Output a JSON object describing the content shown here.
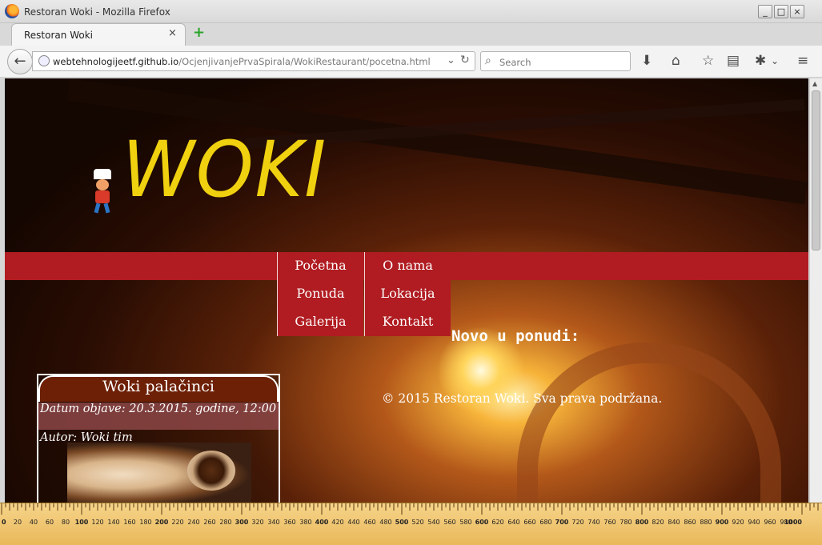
{
  "window": {
    "title": "Restoran Woki - Mozilla Firefox"
  },
  "tab": {
    "label": "Restoran Woki",
    "close": "×",
    "new_tab": "+"
  },
  "nav": {
    "url_host": "webtehnologijeetf.github.io",
    "url_path": "/OcjenjivanjePrvaSpirala/WokiRestaurant/pocetna.html",
    "search_placeholder": "Search"
  },
  "site": {
    "logo": "WOKI",
    "menu": [
      "Početna",
      "O nama",
      "Ponuda",
      "Lokacija",
      "Galerija",
      "Kontakt"
    ],
    "news_heading": "Novo u ponudi:",
    "footer": "© 2015 Restoran Woki. Sva prava podržana.",
    "card": {
      "title": "Woki palačinci",
      "date": "Datum objave: 20.3.2015. godine, 12:00",
      "author": "Autor: Woki tim"
    }
  },
  "ruler": {
    "labels": [
      "0",
      "20",
      "40",
      "60",
      "80",
      "100",
      "120",
      "140",
      "160",
      "180",
      "200",
      "220",
      "240",
      "260",
      "280",
      "300",
      "320",
      "340",
      "360",
      "380",
      "400",
      "420",
      "440",
      "460",
      "480",
      "500",
      "520",
      "540",
      "560",
      "580",
      "600",
      "620",
      "640",
      "660",
      "680",
      "700",
      "720",
      "740",
      "760",
      "780",
      "800",
      "820",
      "840",
      "860",
      "880",
      "900",
      "920",
      "940",
      "960",
      "980",
      "1000"
    ]
  },
  "colors": {
    "accent_red": "#b01c21",
    "logo_yellow": "#f0d10f",
    "card_brown": "#6e2006"
  }
}
